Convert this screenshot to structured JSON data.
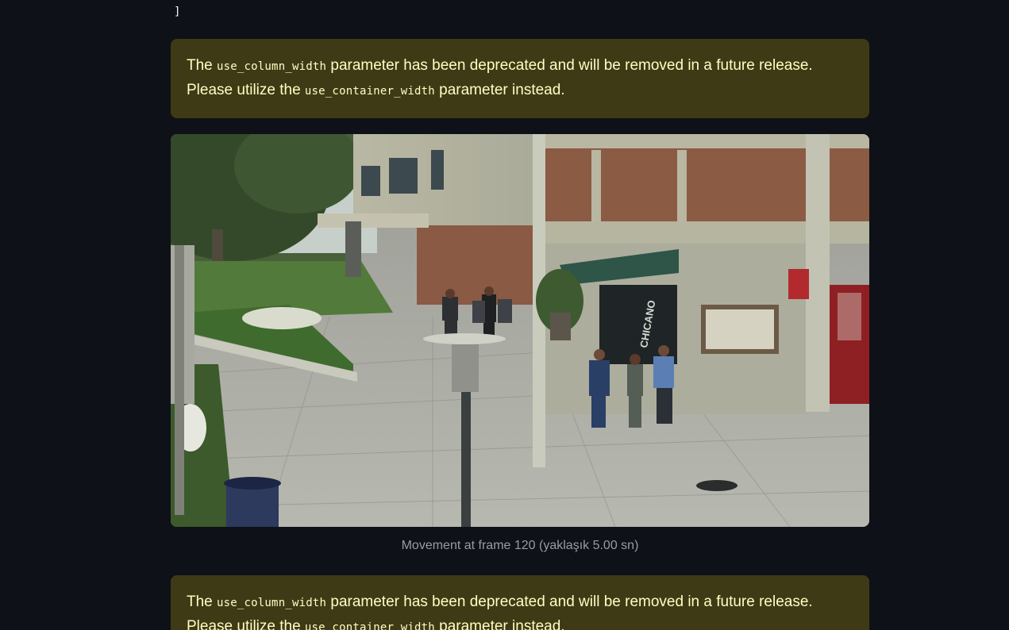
{
  "code_tail": "]",
  "warning_1": {
    "prefix": "The ",
    "param_old": "use_column_width",
    "middle": " parameter has been deprecated and will be removed in a future release. Please utilize the ",
    "param_new": "use_container_width",
    "suffix": " parameter instead."
  },
  "image": {
    "sign_text": "CHICANO"
  },
  "caption": "Movement at frame 120 (yaklaşık 5.00 sn)",
  "warning_2": {
    "prefix": "The ",
    "param_old": "use_column_width",
    "middle": " parameter has been deprecated and will be removed in a future release. Please utilize the ",
    "param_new": "use_container_width",
    "suffix": " parameter instead."
  },
  "colors": {
    "background": "#0e1117",
    "warning_bg": "#3e3a16",
    "warning_text": "#ffffc2",
    "caption_text": "#9a9ba1"
  }
}
